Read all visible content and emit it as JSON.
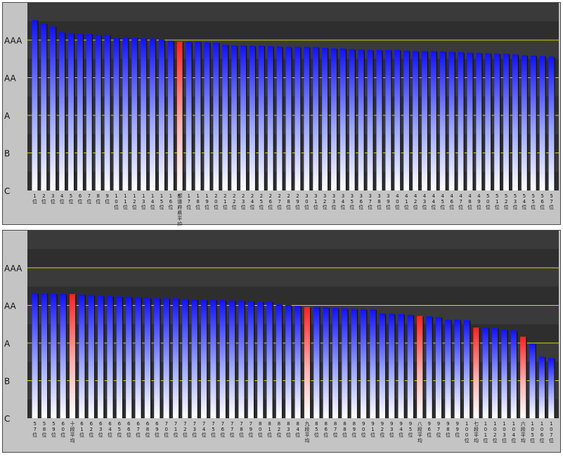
{
  "chart_data": [
    {
      "type": "bar",
      "y_tick_labels": [
        "AAA",
        "AA",
        "A",
        "B",
        "C"
      ],
      "highlight_colors": {
        "bar_top": "#1a1aff",
        "highlight_top": "#ff2a2a",
        "gridline": "#d6d600"
      },
      "categories": [
        "1位",
        "2位",
        "3位",
        "4位",
        "5位",
        "6位",
        "7位",
        "8位",
        "9位",
        "10位",
        "11位",
        "12位",
        "13位",
        "14位",
        "15位",
        "16位",
        "都道府県平均",
        "17位",
        "18位",
        "19位",
        "20位",
        "21位",
        "22位",
        "23位",
        "24位",
        "25位",
        "26位",
        "27位",
        "28位",
        "29位",
        "30位",
        "31位",
        "32位",
        "33位",
        "34位",
        "35位",
        "36位",
        "37位",
        "38位",
        "39位",
        "40位",
        "41位",
        "42位",
        "43位",
        "44位",
        "45位",
        "46位",
        "47位",
        "48位",
        "49位",
        "50位",
        "51位",
        "52位",
        "53位",
        "54位",
        "55位",
        "56位",
        "57位"
      ],
      "values": [
        4.53,
        4.44,
        4.36,
        4.21,
        4.19,
        4.17,
        4.17,
        4.14,
        4.14,
        4.07,
        4.07,
        4.07,
        4.05,
        4.04,
        4.01,
        3.99,
        3.96,
        3.96,
        3.96,
        3.94,
        3.94,
        3.88,
        3.86,
        3.86,
        3.85,
        3.85,
        3.84,
        3.83,
        3.82,
        3.82,
        3.82,
        3.82,
        3.8,
        3.78,
        3.78,
        3.76,
        3.75,
        3.74,
        3.74,
        3.74,
        3.74,
        3.72,
        3.71,
        3.71,
        3.71,
        3.7,
        3.69,
        3.68,
        3.67,
        3.66,
        3.65,
        3.64,
        3.64,
        3.62,
        3.6,
        3.59,
        3.58,
        3.56
      ],
      "highlight_index": 16
    },
    {
      "type": "bar",
      "y_tick_labels": [
        "AAA",
        "AA",
        "A",
        "B",
        "C"
      ],
      "categories": [
        "57位",
        "58位",
        "59位",
        "60位",
        "十段平均",
        "61位",
        "62位",
        "63位",
        "64位",
        "65位",
        "66位",
        "67位",
        "68位",
        "69位",
        "70位",
        "71位",
        "72位",
        "73位",
        "74位",
        "75位",
        "76位",
        "77位",
        "78位",
        "79位",
        "80位",
        "81位",
        "82位",
        "83位",
        "84位",
        "九段平均",
        "85位",
        "86位",
        "87位",
        "88位",
        "89位",
        "90位",
        "91位",
        "92位",
        "93位",
        "94位",
        "95位",
        "八段平均",
        "96位",
        "97位",
        "98位",
        "99位",
        "100位",
        "七段平均",
        "101位",
        "102位",
        "103位",
        "104位",
        "六段平均",
        "105位",
        "106位",
        "107位"
      ],
      "values": [
        3.33,
        3.33,
        3.32,
        3.31,
        3.3,
        3.29,
        3.28,
        3.26,
        3.25,
        3.24,
        3.23,
        3.22,
        3.2,
        3.19,
        3.19,
        3.19,
        3.17,
        3.16,
        3.15,
        3.15,
        3.14,
        3.13,
        3.13,
        3.12,
        3.1,
        3.1,
        3.03,
        3.01,
        2.99,
        2.96,
        2.96,
        2.95,
        2.93,
        2.92,
        2.91,
        2.9,
        2.9,
        2.79,
        2.78,
        2.77,
        2.75,
        2.72,
        2.71,
        2.69,
        2.62,
        2.62,
        2.61,
        2.41,
        2.41,
        2.4,
        2.36,
        2.34,
        2.17,
        1.99,
        1.64,
        1.6
      ],
      "extra_values": [],
      "highlight_index": [
        4,
        29,
        41,
        47,
        52
      ]
    }
  ]
}
